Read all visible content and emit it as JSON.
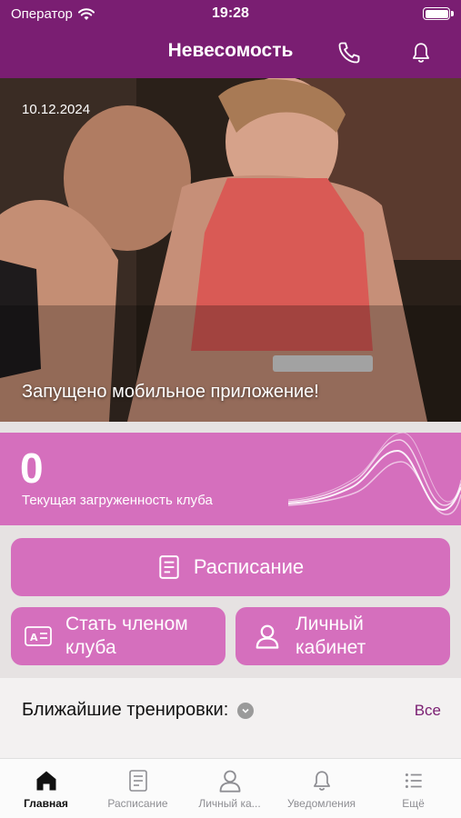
{
  "status_bar": {
    "carrier": "Оператор",
    "time": "19:28"
  },
  "header": {
    "title": "Невесомость",
    "phone_icon": "phone-icon",
    "bell_icon": "bell-icon"
  },
  "hero": {
    "date": "10.12.2024",
    "caption": "Запущено мобильное приложение!"
  },
  "occupancy": {
    "value": "0",
    "label": "Текущая загруженность клуба"
  },
  "buttons": {
    "schedule": "Расписание",
    "become_member_line1": "Стать членом",
    "become_member_line2": "клуба",
    "cabinet_line1": "Личный",
    "cabinet_line2": "кабинет"
  },
  "upcoming": {
    "heading": "Ближайшие тренировки:",
    "all_link": "Все"
  },
  "tab_bar": {
    "items": [
      {
        "label": "Главная",
        "icon": "home-icon",
        "active": true
      },
      {
        "label": "Расписание",
        "icon": "document-icon",
        "active": false
      },
      {
        "label": "Личный ка...",
        "icon": "person-icon",
        "active": false
      },
      {
        "label": "Уведомления",
        "icon": "bell-icon",
        "active": false
      },
      {
        "label": "Ещё",
        "icon": "list-icon",
        "active": false
      }
    ]
  },
  "colors": {
    "brand": "#7a1e72",
    "accent_pink": "#d56fbd",
    "background_gray": "#e6e2e2"
  }
}
